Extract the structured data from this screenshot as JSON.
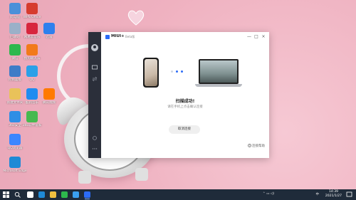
{
  "desktop": {
    "icons": [
      {
        "label": "此电脑",
        "color": "#4a90d9"
      },
      {
        "label": "回收站",
        "color": "#9ab0c8"
      },
      {
        "label": "微信",
        "color": "#2db84d"
      },
      {
        "label": "控制面板",
        "color": "#3e7cc7"
      },
      {
        "label": "新建文件夹",
        "color": "#e9c25a"
      },
      {
        "label": "360安全",
        "color": "#2f8ee5"
      },
      {
        "label": "QQ浏览器",
        "color": "#3a86ff"
      },
      {
        "label": "Microsoft Edge",
        "color": "#1f8ad6"
      },
      {
        "label": "WPS Office",
        "color": "#d63b2e"
      },
      {
        "label": "网易云音乐",
        "color": "#d7263d"
      },
      {
        "label": "搜狗输入法",
        "color": "#f27a1a"
      },
      {
        "label": "QQ",
        "color": "#2aa0e8"
      },
      {
        "label": "酷狗音乐",
        "color": "#1e8cf0"
      },
      {
        "label": "360软件管家",
        "color": "#46b950"
      },
      {
        "label": "迅雷",
        "color": "#2f80ed"
      },
      {
        "label": "腾讯视频",
        "color": "#ff7a00"
      }
    ]
  },
  "window": {
    "app_name": "MIUI+",
    "badge": "Beta版",
    "status_title": "扫描成功!",
    "status_hint": "请在手机上点击确认连接",
    "cancel_button": "取消连接",
    "help_label": "连接帮助",
    "minimize": "—",
    "maximize": "□",
    "close": "×",
    "dot_colors": [
      "#cfd6e4",
      "#2c6cf6",
      "#2c6cf6"
    ]
  },
  "taskbar": {
    "apps": [
      {
        "name": "task-view-icon",
        "color": "#ffffff"
      },
      {
        "name": "edge-icon",
        "color": "#1f8ad6"
      },
      {
        "name": "explorer-icon",
        "color": "#f0c040"
      },
      {
        "name": "wechat-icon",
        "color": "#2db84d"
      },
      {
        "name": "store-icon",
        "color": "#3aa0f0"
      },
      {
        "name": "miui-plus-icon",
        "color": "#2c6cf6"
      }
    ],
    "ime": "中",
    "time": "14:39",
    "date": "2021/1/27"
  }
}
